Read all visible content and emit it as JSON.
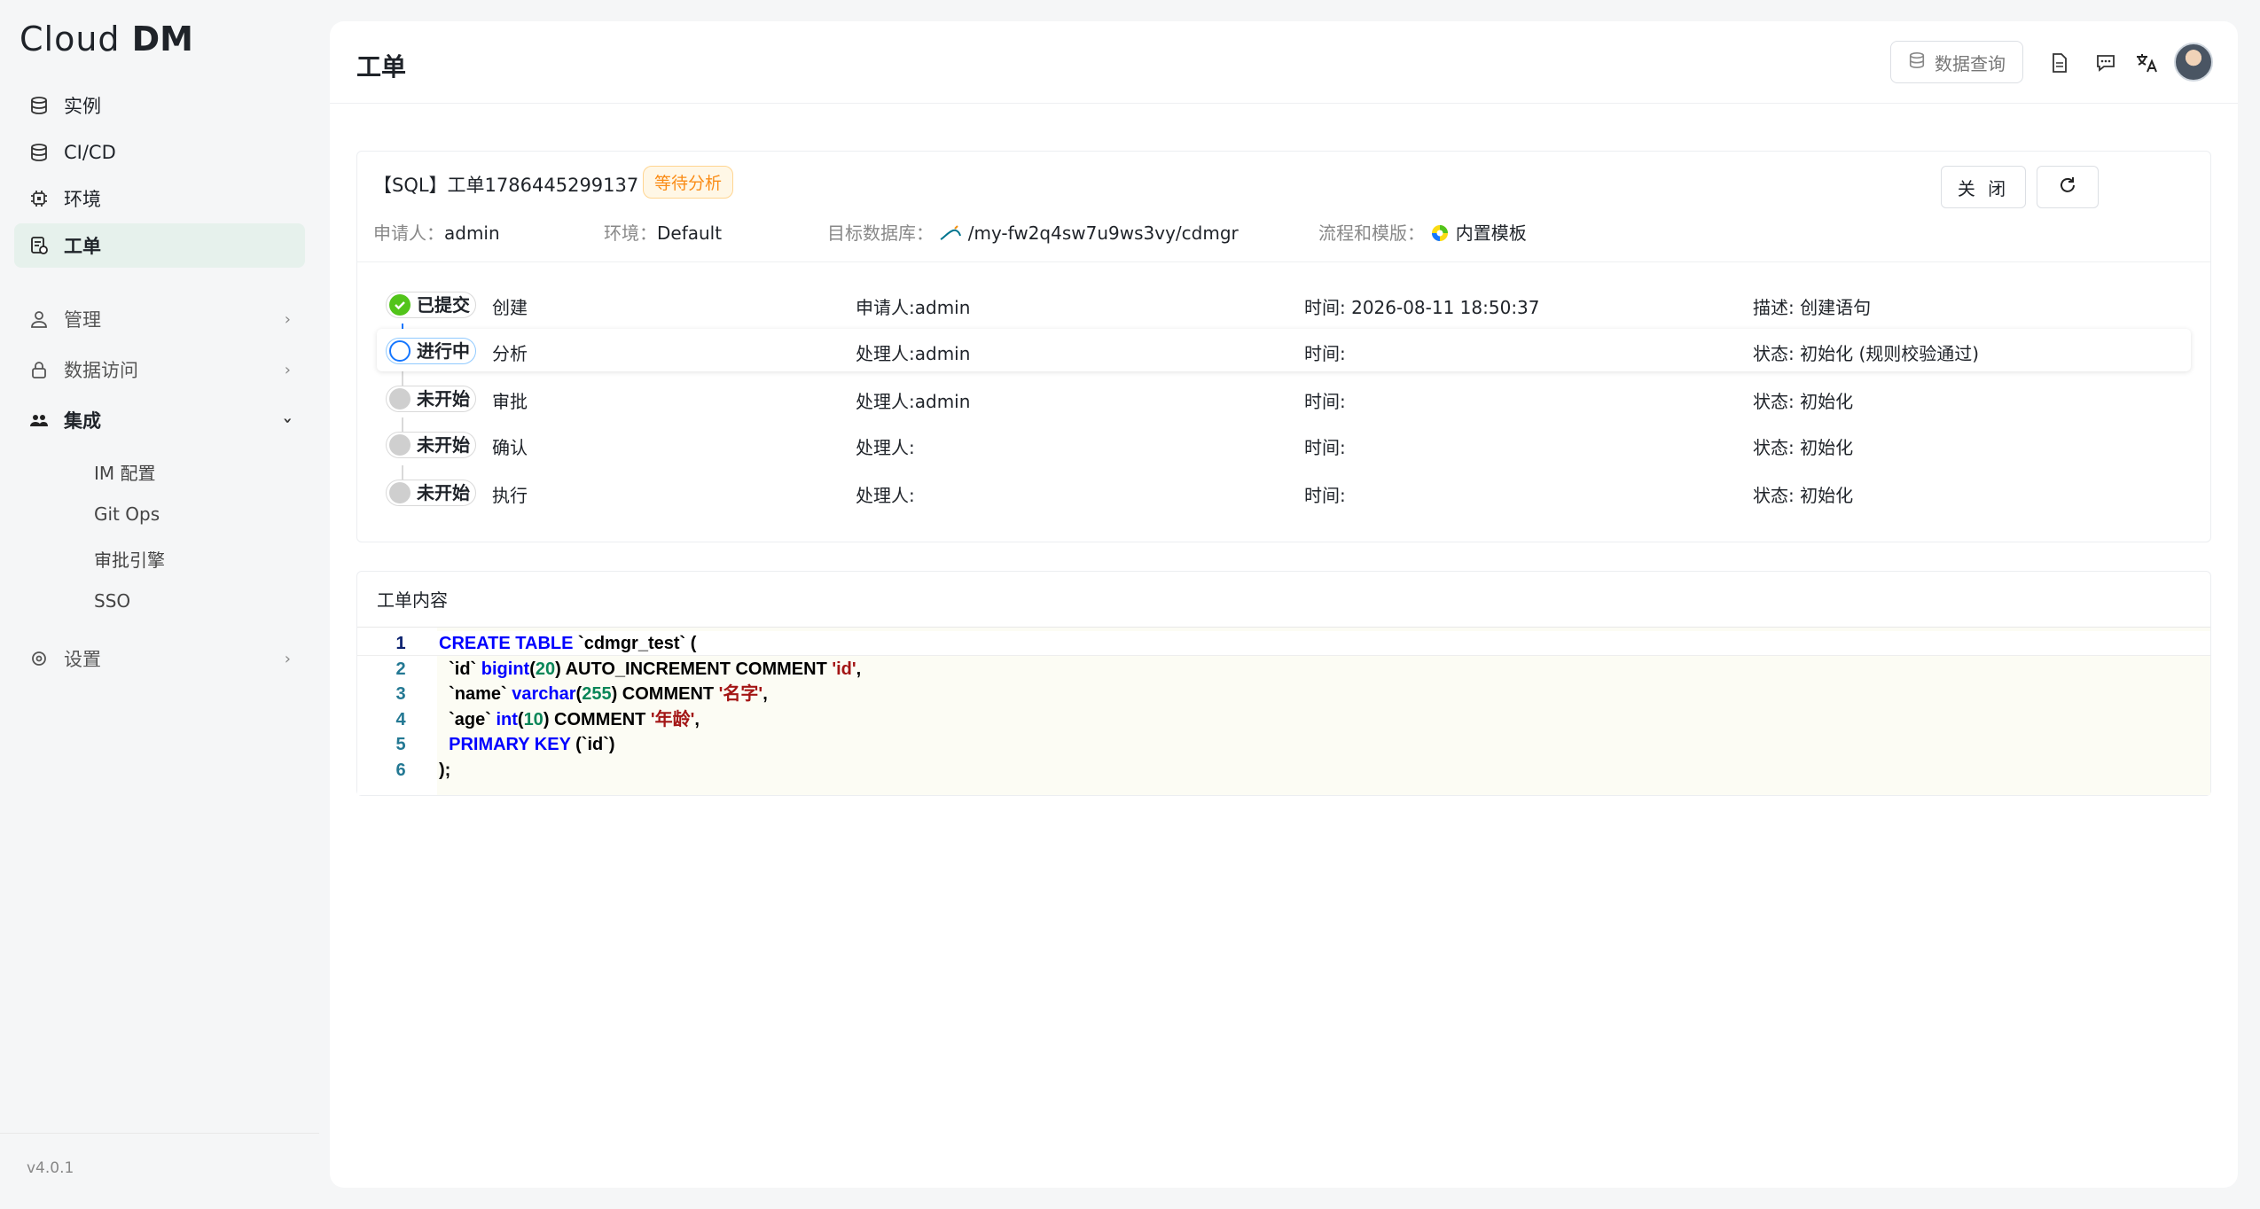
{
  "app": {
    "logo_light": "Cl",
    "logo_mid": "ud ",
    "logo_bold": "DM",
    "version": "v4.0.1"
  },
  "sidebar": {
    "items": [
      {
        "label": "实例"
      },
      {
        "label": "CI/CD"
      },
      {
        "label": "环境"
      },
      {
        "label": "工单"
      },
      {
        "label": "管理"
      },
      {
        "label": "数据访问"
      },
      {
        "label": "集成"
      },
      {
        "label": "设置"
      }
    ],
    "sub_items": [
      {
        "label": "IM 配置"
      },
      {
        "label": "Git Ops"
      },
      {
        "label": "审批引擎"
      },
      {
        "label": "SSO"
      }
    ]
  },
  "header": {
    "title": "工单",
    "query_button": "数据查询",
    "icons": [
      "doc-icon",
      "comment-icon",
      "translate-icon"
    ]
  },
  "ticket": {
    "title": "【SQL】工单1786445299137",
    "status_tag": "等待分析",
    "close_button": "关 闭",
    "meta": {
      "applicant_label": "申请人：",
      "applicant": "admin",
      "env_label": "环境：",
      "env": "Default",
      "target_label": "目标数据库：",
      "target": "/my-fw2q4sw7u9ws3vy/cdmgr",
      "flow_label": "流程和模版：",
      "flow": "内置模板"
    },
    "steps": [
      {
        "badge": "已提交",
        "name": "创建",
        "c1": "申请人:admin",
        "c2": "时间:  2026-08-11 18:50:37",
        "c3": "描述:  创建语句"
      },
      {
        "badge": "进行中",
        "name": "分析",
        "c1": "处理人:admin",
        "c2": "时间:",
        "c3": "状态:  初始化 (规则校验通过)"
      },
      {
        "badge": "未开始",
        "name": "审批",
        "c1": "处理人:admin",
        "c2": "时间:",
        "c3": "状态:  初始化"
      },
      {
        "badge": "未开始",
        "name": "确认",
        "c1": "处理人:",
        "c2": "时间:",
        "c3": "状态:  初始化"
      },
      {
        "badge": "未开始",
        "name": "执行",
        "c1": "处理人:",
        "c2": "时间:",
        "c3": "状态:  初始化"
      }
    ]
  },
  "content": {
    "title": "工单内容",
    "lines": [
      {
        "n": "1",
        "parts": [
          [
            "kw",
            "CREATE TABLE"
          ],
          [
            "plain",
            " `cdmgr_test` ("
          ]
        ]
      },
      {
        "n": "2",
        "parts": [
          [
            "plain",
            "  `id` "
          ],
          [
            "kw",
            "bigint"
          ],
          [
            "plain",
            "("
          ],
          [
            "num",
            "20"
          ],
          [
            "plain",
            ") AUTO_INCREMENT COMMENT "
          ],
          [
            "str",
            "'id'"
          ],
          [
            "plain",
            ","
          ]
        ]
      },
      {
        "n": "3",
        "parts": [
          [
            "plain",
            "  `name` "
          ],
          [
            "kw",
            "varchar"
          ],
          [
            "plain",
            "("
          ],
          [
            "num",
            "255"
          ],
          [
            "plain",
            ") COMMENT "
          ],
          [
            "str",
            "'名字'"
          ],
          [
            "plain",
            ","
          ]
        ]
      },
      {
        "n": "4",
        "parts": [
          [
            "plain",
            "  `age` "
          ],
          [
            "kw",
            "int"
          ],
          [
            "plain",
            "("
          ],
          [
            "num",
            "10"
          ],
          [
            "plain",
            ") COMMENT "
          ],
          [
            "str",
            "'年龄'"
          ],
          [
            "plain",
            ","
          ]
        ]
      },
      {
        "n": "5",
        "parts": [
          [
            "kw",
            "  PRIMARY KEY"
          ],
          [
            "plain",
            " (`id`)"
          ]
        ]
      },
      {
        "n": "6",
        "parts": [
          [
            "plain",
            ");"
          ]
        ]
      }
    ]
  }
}
